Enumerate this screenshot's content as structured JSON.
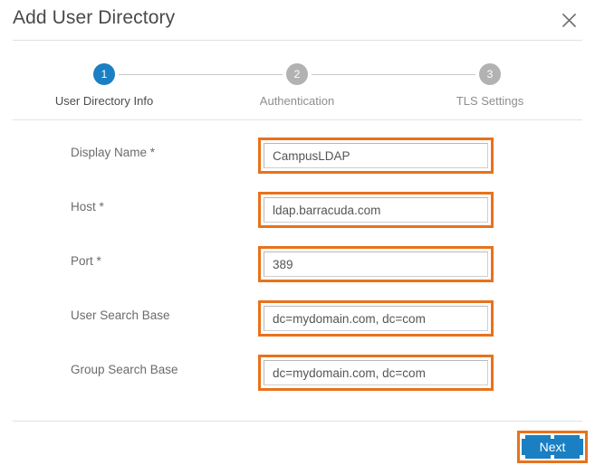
{
  "dialog": {
    "title": "Add User Directory",
    "close_icon": "close-icon"
  },
  "stepper": {
    "steps": [
      {
        "number": "1",
        "label": "User Directory Info",
        "state": "active"
      },
      {
        "number": "2",
        "label": "Authentication",
        "state": "inactive"
      },
      {
        "number": "3",
        "label": "TLS Settings",
        "state": "inactive"
      }
    ]
  },
  "form": {
    "fields": [
      {
        "label": "Display Name *",
        "value": "CampusLDAP",
        "placeholder": ""
      },
      {
        "label": "Host *",
        "value": "ldap.barracuda.com",
        "placeholder": ""
      },
      {
        "label": "Port *",
        "value": "389",
        "placeholder": ""
      },
      {
        "label": "User Search Base",
        "value": "dc=mydomain.com, dc=com",
        "placeholder": ""
      },
      {
        "label": "Group Search Base",
        "value": "dc=mydomain.com, dc=com",
        "placeholder": ""
      }
    ]
  },
  "footer": {
    "next_label": "Next"
  },
  "colors": {
    "accent_blue": "#1b7fc3",
    "highlight_orange": "#e8721c",
    "step_inactive_gray": "#b2b2b2",
    "divider_gray": "#e2e2e2",
    "label_gray": "#6b6b6b"
  }
}
